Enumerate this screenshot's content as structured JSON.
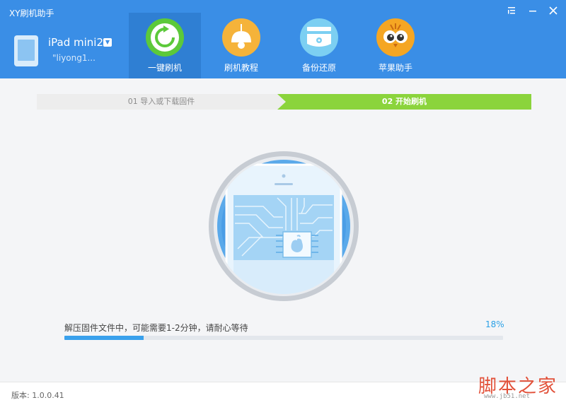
{
  "app": {
    "title": "XY刷机助手"
  },
  "window": {
    "menu_icon": "list-menu-icon",
    "minimize_icon": "minimize-icon",
    "close_icon": "close-icon"
  },
  "device": {
    "name": "iPad mini2",
    "user": "\"liyong1...",
    "icon": "tablet-icon",
    "dropdown_icon": "chevron-down-icon"
  },
  "nav": {
    "items": [
      {
        "label": "一键刷机",
        "icon": "refresh-icon",
        "active": true,
        "color": "#5cc93a"
      },
      {
        "label": "刷机教程",
        "icon": "lamp-icon",
        "active": false,
        "color": "#f5b33a"
      },
      {
        "label": "备份还原",
        "icon": "disk-icon",
        "active": false,
        "color": "#7ccff2"
      },
      {
        "label": "苹果助手",
        "icon": "owl-icon",
        "active": false,
        "color": "#f5a623"
      }
    ]
  },
  "steps": [
    {
      "label": "01 导入或下载固件",
      "active": false
    },
    {
      "label": "02 开始刷机",
      "active": true
    }
  ],
  "progress": {
    "message": "解压固件文件中，可能需要1-2分钟，请耐心等待",
    "percent_label": "18%",
    "percent": 18
  },
  "footer": {
    "version": "版本: 1.0.0.41"
  },
  "watermark": {
    "text": "脚本之家",
    "url": "www.jb51.net"
  },
  "colors": {
    "header": "#3a8ee6",
    "active_step": "#8bd43c",
    "progress": "#3aa1ec"
  }
}
